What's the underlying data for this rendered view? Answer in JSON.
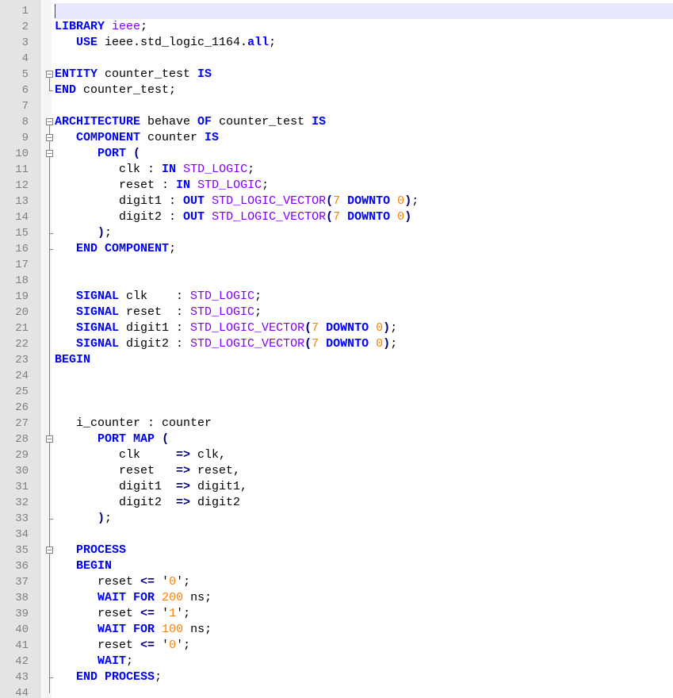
{
  "editor": {
    "lines": [
      {
        "n": "1",
        "segs": []
      },
      {
        "n": "2",
        "segs": [
          [
            "kw",
            "LIBRARY"
          ],
          [
            "t",
            " "
          ],
          [
            "lib",
            "ieee"
          ],
          [
            "t",
            ";"
          ]
        ]
      },
      {
        "n": "3",
        "segs": [
          [
            "t",
            "   "
          ],
          [
            "kw",
            "USE"
          ],
          [
            "t",
            " ieee.std_logic_1164."
          ],
          [
            "kw",
            "all"
          ],
          [
            "t",
            ";"
          ]
        ]
      },
      {
        "n": "4",
        "segs": []
      },
      {
        "n": "5",
        "segs": [
          [
            "kw",
            "ENTITY"
          ],
          [
            "t",
            " counter_test "
          ],
          [
            "kw",
            "IS"
          ]
        ]
      },
      {
        "n": "6",
        "segs": [
          [
            "kw",
            "END"
          ],
          [
            "t",
            " counter_test;"
          ]
        ]
      },
      {
        "n": "7",
        "segs": []
      },
      {
        "n": "8",
        "segs": [
          [
            "kw",
            "ARCHITECTURE"
          ],
          [
            "t",
            " behave "
          ],
          [
            "kw",
            "OF"
          ],
          [
            "t",
            " counter_test "
          ],
          [
            "kw",
            "IS"
          ]
        ]
      },
      {
        "n": "9",
        "segs": [
          [
            "t",
            "   "
          ],
          [
            "kw",
            "COMPONENT"
          ],
          [
            "t",
            " counter "
          ],
          [
            "kw",
            "IS"
          ]
        ]
      },
      {
        "n": "10",
        "segs": [
          [
            "t",
            "      "
          ],
          [
            "kw",
            "PORT"
          ],
          [
            "t",
            " "
          ],
          [
            "ops",
            "("
          ]
        ]
      },
      {
        "n": "11",
        "segs": [
          [
            "t",
            "         clk : "
          ],
          [
            "kw",
            "IN"
          ],
          [
            "t",
            " "
          ],
          [
            "type",
            "STD_LOGIC"
          ],
          [
            "t",
            ";"
          ]
        ]
      },
      {
        "n": "12",
        "segs": [
          [
            "t",
            "         reset : "
          ],
          [
            "kw",
            "IN"
          ],
          [
            "t",
            " "
          ],
          [
            "type",
            "STD_LOGIC"
          ],
          [
            "t",
            ";"
          ]
        ]
      },
      {
        "n": "13",
        "segs": [
          [
            "t",
            "         digit1 : "
          ],
          [
            "kw",
            "OUT"
          ],
          [
            "t",
            " "
          ],
          [
            "type",
            "STD_LOGIC_VECTOR"
          ],
          [
            "ops",
            "("
          ],
          [
            "num",
            "7"
          ],
          [
            "t",
            " "
          ],
          [
            "kw",
            "DOWNTO"
          ],
          [
            "t",
            " "
          ],
          [
            "num",
            "0"
          ],
          [
            "ops",
            ")"
          ],
          [
            "t",
            ";"
          ]
        ]
      },
      {
        "n": "14",
        "segs": [
          [
            "t",
            "         digit2 : "
          ],
          [
            "kw",
            "OUT"
          ],
          [
            "t",
            " "
          ],
          [
            "type",
            "STD_LOGIC_VECTOR"
          ],
          [
            "ops",
            "("
          ],
          [
            "num",
            "7"
          ],
          [
            "t",
            " "
          ],
          [
            "kw",
            "DOWNTO"
          ],
          [
            "t",
            " "
          ],
          [
            "num",
            "0"
          ],
          [
            "ops",
            ")"
          ]
        ]
      },
      {
        "n": "15",
        "segs": [
          [
            "t",
            "      "
          ],
          [
            "ops",
            ")"
          ],
          [
            "t",
            ";"
          ]
        ]
      },
      {
        "n": "16",
        "segs": [
          [
            "t",
            "   "
          ],
          [
            "kw",
            "END"
          ],
          [
            "t",
            " "
          ],
          [
            "kw",
            "COMPONENT"
          ],
          [
            "t",
            ";"
          ]
        ]
      },
      {
        "n": "17",
        "segs": []
      },
      {
        "n": "18",
        "segs": []
      },
      {
        "n": "19",
        "segs": [
          [
            "t",
            "   "
          ],
          [
            "kw",
            "SIGNAL"
          ],
          [
            "t",
            " clk    : "
          ],
          [
            "type",
            "STD_LOGIC"
          ],
          [
            "t",
            ";"
          ]
        ]
      },
      {
        "n": "20",
        "segs": [
          [
            "t",
            "   "
          ],
          [
            "kw",
            "SIGNAL"
          ],
          [
            "t",
            " reset  : "
          ],
          [
            "type",
            "STD_LOGIC"
          ],
          [
            "t",
            ";"
          ]
        ]
      },
      {
        "n": "21",
        "segs": [
          [
            "t",
            "   "
          ],
          [
            "kw",
            "SIGNAL"
          ],
          [
            "t",
            " digit1 : "
          ],
          [
            "type",
            "STD_LOGIC_VECTOR"
          ],
          [
            "ops",
            "("
          ],
          [
            "num",
            "7"
          ],
          [
            "t",
            " "
          ],
          [
            "kw",
            "DOWNTO"
          ],
          [
            "t",
            " "
          ],
          [
            "num",
            "0"
          ],
          [
            "ops",
            ")"
          ],
          [
            "t",
            ";"
          ]
        ]
      },
      {
        "n": "22",
        "segs": [
          [
            "t",
            "   "
          ],
          [
            "kw",
            "SIGNAL"
          ],
          [
            "t",
            " digit2 : "
          ],
          [
            "type",
            "STD_LOGIC_VECTOR"
          ],
          [
            "ops",
            "("
          ],
          [
            "num",
            "7"
          ],
          [
            "t",
            " "
          ],
          [
            "kw",
            "DOWNTO"
          ],
          [
            "t",
            " "
          ],
          [
            "num",
            "0"
          ],
          [
            "ops",
            ")"
          ],
          [
            "t",
            ";"
          ]
        ]
      },
      {
        "n": "23",
        "segs": [
          [
            "kw",
            "BEGIN"
          ]
        ]
      },
      {
        "n": "24",
        "segs": []
      },
      {
        "n": "25",
        "segs": []
      },
      {
        "n": "26",
        "segs": []
      },
      {
        "n": "27",
        "segs": [
          [
            "t",
            "   i_counter : counter"
          ]
        ]
      },
      {
        "n": "28",
        "segs": [
          [
            "t",
            "      "
          ],
          [
            "kw",
            "PORT"
          ],
          [
            "t",
            " "
          ],
          [
            "kw",
            "MAP"
          ],
          [
            "t",
            " "
          ],
          [
            "ops",
            "("
          ]
        ]
      },
      {
        "n": "29",
        "segs": [
          [
            "t",
            "         clk     "
          ],
          [
            "ops",
            "=>"
          ],
          [
            "t",
            " clk,"
          ]
        ]
      },
      {
        "n": "30",
        "segs": [
          [
            "t",
            "         reset   "
          ],
          [
            "ops",
            "=>"
          ],
          [
            "t",
            " reset,"
          ]
        ]
      },
      {
        "n": "31",
        "segs": [
          [
            "t",
            "         digit1  "
          ],
          [
            "ops",
            "=>"
          ],
          [
            "t",
            " digit1,"
          ]
        ]
      },
      {
        "n": "32",
        "segs": [
          [
            "t",
            "         digit2  "
          ],
          [
            "ops",
            "=>"
          ],
          [
            "t",
            " digit2"
          ]
        ]
      },
      {
        "n": "33",
        "segs": [
          [
            "t",
            "      "
          ],
          [
            "ops",
            ")"
          ],
          [
            "t",
            ";"
          ]
        ]
      },
      {
        "n": "34",
        "segs": []
      },
      {
        "n": "35",
        "segs": [
          [
            "t",
            "   "
          ],
          [
            "kw",
            "PROCESS"
          ]
        ]
      },
      {
        "n": "36",
        "segs": [
          [
            "t",
            "   "
          ],
          [
            "kw",
            "BEGIN"
          ]
        ]
      },
      {
        "n": "37",
        "segs": [
          [
            "t",
            "      reset "
          ],
          [
            "ops",
            "<="
          ],
          [
            "t",
            " '"
          ],
          [
            "num",
            "0"
          ],
          [
            "t",
            "';"
          ]
        ]
      },
      {
        "n": "38",
        "segs": [
          [
            "t",
            "      "
          ],
          [
            "kw",
            "WAIT"
          ],
          [
            "t",
            " "
          ],
          [
            "kw",
            "FOR"
          ],
          [
            "t",
            " "
          ],
          [
            "num",
            "200"
          ],
          [
            "t",
            " ns;"
          ]
        ]
      },
      {
        "n": "39",
        "segs": [
          [
            "t",
            "      reset "
          ],
          [
            "ops",
            "<="
          ],
          [
            "t",
            " '"
          ],
          [
            "num",
            "1"
          ],
          [
            "t",
            "';"
          ]
        ]
      },
      {
        "n": "40",
        "segs": [
          [
            "t",
            "      "
          ],
          [
            "kw",
            "WAIT"
          ],
          [
            "t",
            " "
          ],
          [
            "kw",
            "FOR"
          ],
          [
            "t",
            " "
          ],
          [
            "num",
            "100"
          ],
          [
            "t",
            " ns;"
          ]
        ]
      },
      {
        "n": "41",
        "segs": [
          [
            "t",
            "      reset "
          ],
          [
            "ops",
            "<="
          ],
          [
            "t",
            " '"
          ],
          [
            "num",
            "0"
          ],
          [
            "t",
            "';"
          ]
        ]
      },
      {
        "n": "42",
        "segs": [
          [
            "t",
            "      "
          ],
          [
            "kw",
            "WAIT"
          ],
          [
            "t",
            ";"
          ]
        ]
      },
      {
        "n": "43",
        "segs": [
          [
            "t",
            "   "
          ],
          [
            "kw",
            "END"
          ],
          [
            "t",
            " "
          ],
          [
            "kw",
            "PROCESS"
          ],
          [
            "t",
            ";"
          ]
        ]
      },
      {
        "n": "44",
        "segs": []
      }
    ]
  },
  "colors": {
    "keyword": "#0000ff",
    "type": "#8000ff",
    "number": "#ff8000",
    "gutter": "#e4e4e4",
    "current_line": "#e8e8ff"
  }
}
